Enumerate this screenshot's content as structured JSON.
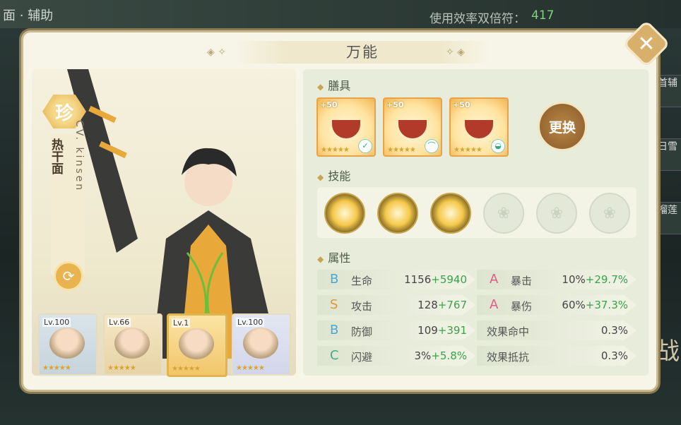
{
  "background": {
    "top_left_text": "面 · 辅助",
    "top_center_text": "使用效率双倍符：",
    "top_center_count": "417",
    "right_items": [
      "首辅",
      "日雪",
      "榴莲"
    ],
    "left_edge_text": "战"
  },
  "dialog": {
    "title": "万能",
    "close_label": "✕"
  },
  "character": {
    "rarity": "珍",
    "name": "热干面",
    "cv": "CV. kinsen",
    "swap_icon": "refresh-icon"
  },
  "team": [
    {
      "level": "Lv.100",
      "stars": "★★★★★",
      "selected": false
    },
    {
      "level": "Lv.66",
      "stars": "★★★★★",
      "selected": false
    },
    {
      "level": "Lv.1",
      "stars": "★★★★★",
      "selected": true
    },
    {
      "level": "Lv.100",
      "stars": "★★★★★",
      "selected": false
    }
  ],
  "sections": {
    "food": "膳具",
    "skills": "技能",
    "attributes": "属性"
  },
  "foods": [
    {
      "bonus": "+50",
      "stars": "★★★★★",
      "tag": "✓"
    },
    {
      "bonus": "+50",
      "stars": "★★★★★",
      "tag": "⌒"
    },
    {
      "bonus": "+50",
      "stars": "★★★★★",
      "tag": "◒"
    }
  ],
  "change_button": "更换",
  "skills": {
    "active_count": 3,
    "locked_count": 3,
    "locked_icon": "fan-icon"
  },
  "stats": [
    {
      "grade": "B",
      "name": "生命",
      "base": "1156",
      "bonus": "+5940"
    },
    {
      "grade": "A",
      "name": "暴击",
      "base": "10%",
      "bonus": "+29.7%"
    },
    {
      "grade": "S",
      "name": "攻击",
      "base": "128",
      "bonus": "+767"
    },
    {
      "grade": "A",
      "name": "暴伤",
      "base": "60%",
      "bonus": "+37.3%"
    },
    {
      "grade": "B",
      "name": "防御",
      "base": "109",
      "bonus": "+391"
    },
    {
      "grade": "",
      "name": "效果命中",
      "base": "0.3%",
      "bonus": ""
    },
    {
      "grade": "C",
      "name": "闪避",
      "base": "3%",
      "bonus": "+5.8%"
    },
    {
      "grade": "",
      "name": "效果抵抗",
      "base": "0.3%",
      "bonus": ""
    }
  ],
  "colors": {
    "accent_gold": "#d9b06b",
    "bonus_green": "#3aa24a",
    "panel_bg": "#e8ecda"
  }
}
